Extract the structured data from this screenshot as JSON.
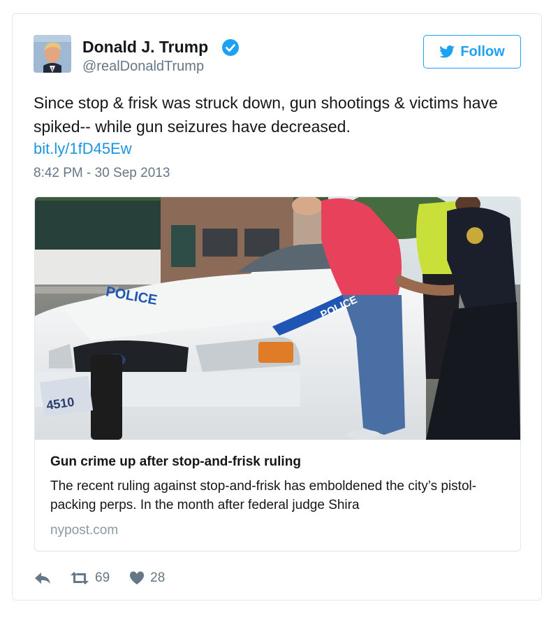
{
  "tweet": {
    "author": {
      "display_name": "Donald J. Trump",
      "handle": "@realDonaldTrump",
      "verified": true,
      "avatar": "profile-photo"
    },
    "follow_button": {
      "label": "Follow",
      "icon": "twitter-bird-icon"
    },
    "text": "Since stop & frisk was struck down, gun shootings & victims have spiked-- while gun seizures have decreased.",
    "link": "bit.ly/1fD45Ew",
    "timestamp": "8:42 PM - 30 Sep 2013",
    "card": {
      "image_alt": "Police officers frisking a man against a police car",
      "image_car_markings": [
        "POLICE",
        "POLICE",
        "4510"
      ],
      "title": "Gun crime up after stop-and-frisk ruling",
      "description": "The recent ruling against stop-and-frisk has emboldened the city’s pistol-packing perps. In the month after federal judge Shira",
      "domain": "nypost.com"
    },
    "actions": {
      "reply_icon": "reply-icon",
      "retweet_icon": "retweet-icon",
      "retweet_count": "69",
      "like_icon": "heart-icon",
      "like_count": "28"
    }
  },
  "colors": {
    "accent": "#1da1f2",
    "link": "#1b95e0",
    "muted": "#657786",
    "border": "#e1e8ed"
  }
}
